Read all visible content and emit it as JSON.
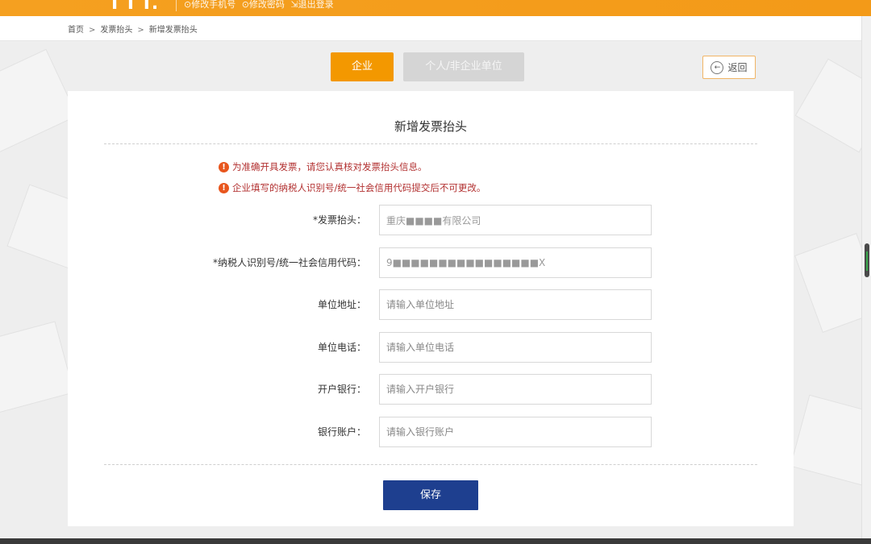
{
  "header": {
    "logo_fragment": "I I I.",
    "links": [
      "⊙修改手机号",
      "⊙修改密码",
      "⇲退出登录"
    ]
  },
  "breadcrumb": {
    "items": [
      "首页",
      "发票抬头",
      "新增发票抬头"
    ],
    "separator": ">"
  },
  "tabs": {
    "company": "企业",
    "personal": "个人/非企业单位",
    "active": "company"
  },
  "back_button": {
    "label": "返回",
    "icon": "arrow-left-circle-icon"
  },
  "form": {
    "title": "新增发票抬头",
    "notices": [
      "为准确开具发票，请您认真核对发票抬头信息。",
      "企业填写的纳税人识别号/统一社会信用代码提交后不可更改。"
    ],
    "fields": [
      {
        "label": "*发票抬头：",
        "value": "重庆■■■■有限公司",
        "placeholder": ""
      },
      {
        "label": "*纳税人识别号/统一社会信用代码：",
        "value": "9■■■■■■■■■■■■■■■■X",
        "placeholder": ""
      },
      {
        "label": "单位地址：",
        "value": "",
        "placeholder": "请输入单位地址"
      },
      {
        "label": "单位电话：",
        "value": "",
        "placeholder": "请输入单位电话"
      },
      {
        "label": "开户银行：",
        "value": "",
        "placeholder": "请输入开户银行"
      },
      {
        "label": "银行账户：",
        "value": "",
        "placeholder": "请输入银行账户"
      }
    ],
    "save_label": "保存"
  },
  "colors": {
    "header_orange": "#f5a020",
    "tab_active": "#f39800",
    "tab_inactive": "#d5d5d5",
    "notice_text": "#b23030",
    "warn_icon": "#e8561e",
    "save_button": "#1e3f8f"
  }
}
